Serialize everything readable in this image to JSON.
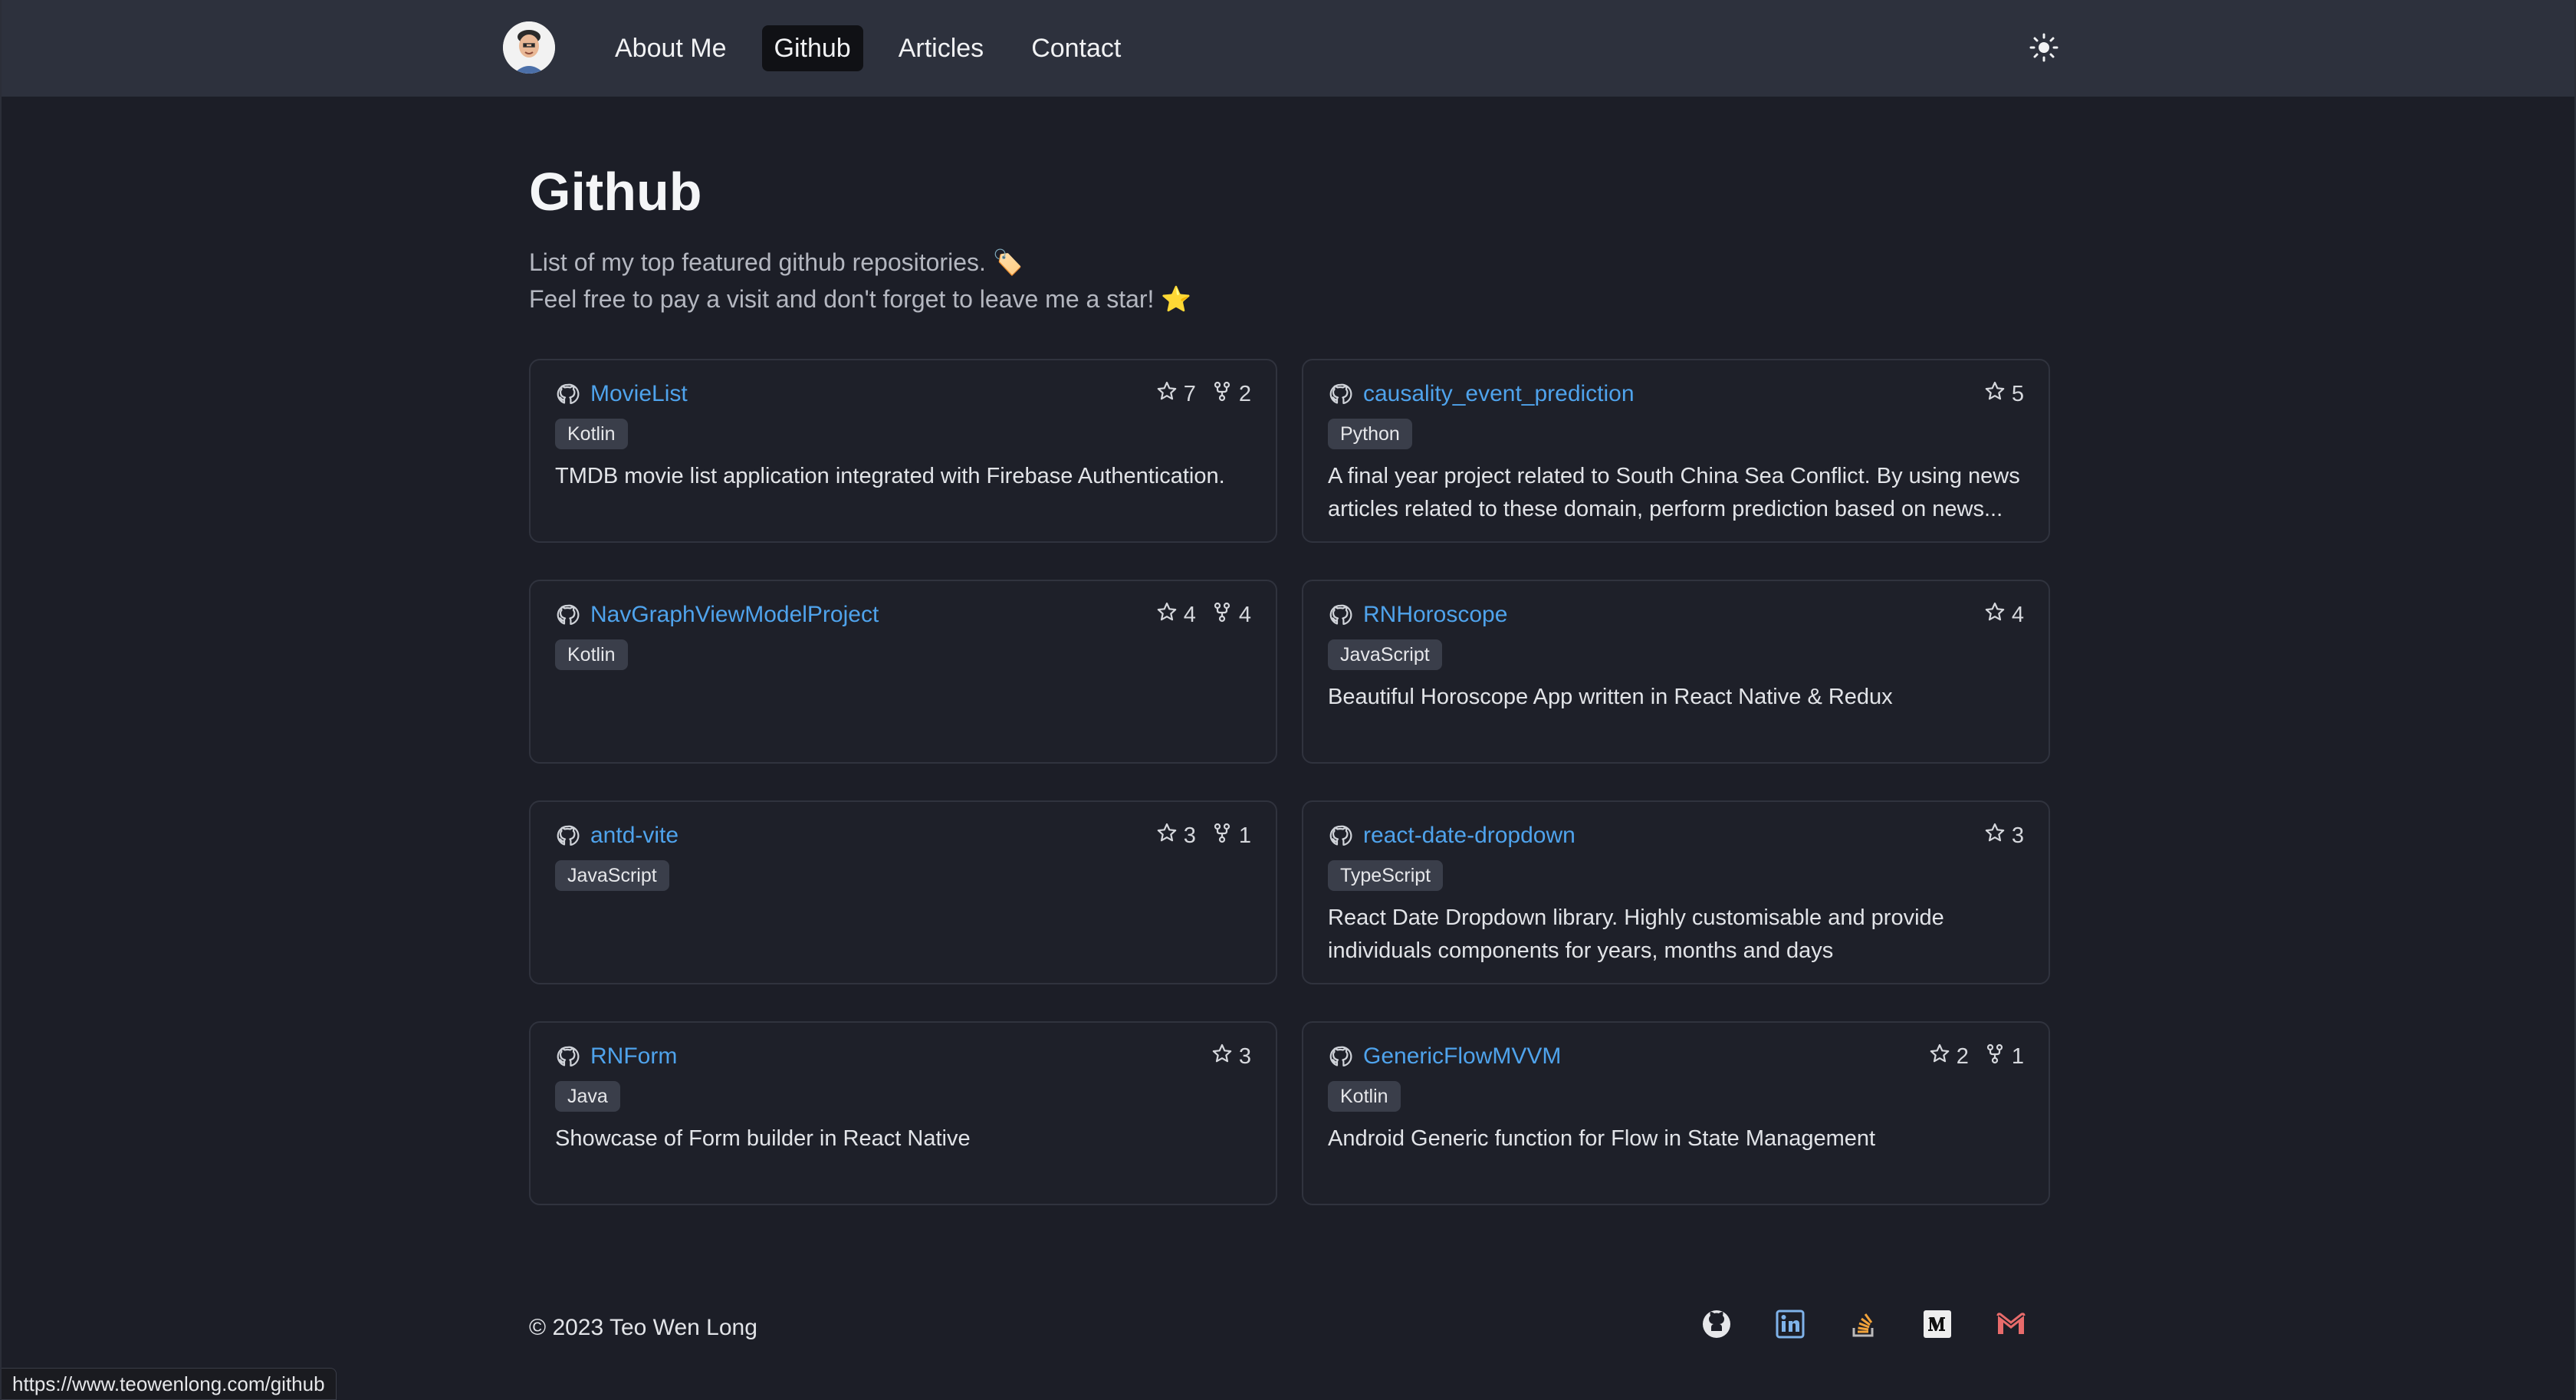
{
  "nav": {
    "items": [
      {
        "label": "About Me",
        "active": false
      },
      {
        "label": "Github",
        "active": true
      },
      {
        "label": "Articles",
        "active": false
      },
      {
        "label": "Contact",
        "active": false
      }
    ]
  },
  "main": {
    "title": "Github",
    "intro_line1": "List of my top featured github repositories. 🏷️",
    "intro_line2": "Feel free to pay a visit and don't forget to leave me a star! ⭐"
  },
  "repos": [
    {
      "name": "MovieList",
      "language": "Kotlin",
      "stars": "7",
      "forks": "2",
      "description": "TMDB movie list application integrated with Firebase Authentication."
    },
    {
      "name": "causality_event_prediction",
      "language": "Python",
      "stars": "5",
      "forks": "",
      "description": "A final year project related to South China Sea Conflict. By using news articles related to these domain, perform prediction based on news..."
    },
    {
      "name": "NavGraphViewModelProject",
      "language": "Kotlin",
      "stars": "4",
      "forks": "4",
      "description": ""
    },
    {
      "name": "RNHoroscope",
      "language": "JavaScript",
      "stars": "4",
      "forks": "",
      "description": "Beautiful Horoscope App written in React Native & Redux"
    },
    {
      "name": "antd-vite",
      "language": "JavaScript",
      "stars": "3",
      "forks": "1",
      "description": ""
    },
    {
      "name": "react-date-dropdown",
      "language": "TypeScript",
      "stars": "3",
      "forks": "",
      "description": "React Date Dropdown library. Highly customisable and provide individuals components for years, months and days"
    },
    {
      "name": "RNForm",
      "language": "Java",
      "stars": "3",
      "forks": "",
      "description": "Showcase of Form builder in React Native"
    },
    {
      "name": "GenericFlowMVVM",
      "language": "Kotlin",
      "stars": "2",
      "forks": "1",
      "description": "Android Generic function for Flow in State Management"
    }
  ],
  "footer": {
    "copyright": "© 2023 Teo Wen Long",
    "socials": [
      "github-icon",
      "linkedin-icon",
      "stackoverflow-icon",
      "medium-icon",
      "gmail-icon"
    ]
  },
  "status_bar": {
    "url": "https://www.teowenlong.com/github"
  },
  "colors": {
    "accent": "#4fa3ec",
    "header_bg": "#2d313d",
    "page_bg": "#1c1e27",
    "card_border": "#30333e",
    "badge_bg": "#3a3e4a"
  }
}
